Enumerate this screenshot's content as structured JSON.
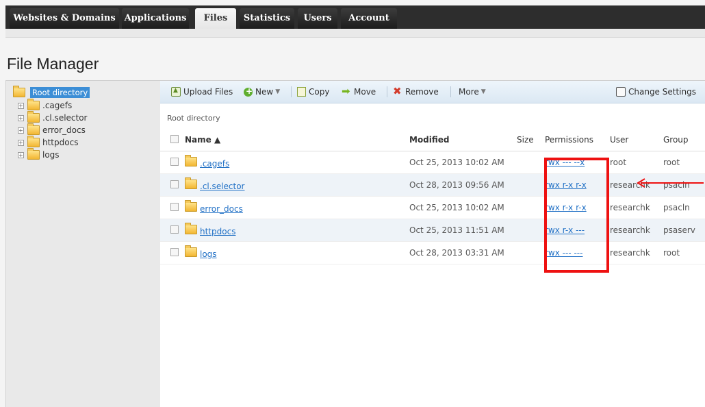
{
  "tabs": [
    {
      "label": "Websites & Domains",
      "active": false
    },
    {
      "label": "Applications",
      "active": false
    },
    {
      "label": "Files",
      "active": true
    },
    {
      "label": "Statistics",
      "active": false
    },
    {
      "label": "Users",
      "active": false
    },
    {
      "label": "Account",
      "active": false
    }
  ],
  "page_title": "File Manager",
  "tree": {
    "root": "Root directory",
    "items": [
      ".cagefs",
      ".cl.selector",
      "error_docs",
      "httpdocs",
      "logs"
    ]
  },
  "toolbar": {
    "upload": "Upload Files",
    "new": "New",
    "copy": "Copy",
    "move": "Move",
    "remove": "Remove",
    "more": "More",
    "change_settings": "Change Settings"
  },
  "breadcrumb": "Root directory",
  "table": {
    "headers": {
      "name": "Name ▲",
      "modified": "Modified",
      "size": "Size",
      "permissions": "Permissions",
      "user": "User",
      "group": "Group"
    },
    "rows": [
      {
        "name": ".cagefs",
        "modified": "Oct 25, 2013 10:02 AM",
        "size": "",
        "permissions": "rwx --- --x",
        "user": "root",
        "group": "root"
      },
      {
        "name": ".cl.selector",
        "modified": "Oct 28, 2013 09:56 AM",
        "size": "",
        "permissions": "rwx r-x r-x",
        "user": "researchk",
        "group": "psacln"
      },
      {
        "name": "error_docs",
        "modified": "Oct 25, 2013 10:02 AM",
        "size": "",
        "permissions": "rwx r-x r-x",
        "user": "researchk",
        "group": "psacln"
      },
      {
        "name": "httpdocs",
        "modified": "Oct 25, 2013 11:51 AM",
        "size": "",
        "permissions": "rwx r-x ---",
        "user": "researchk",
        "group": "psaserv"
      },
      {
        "name": "logs",
        "modified": "Oct 28, 2013 03:31 AM",
        "size": "",
        "permissions": "rwx --- ---",
        "user": "researchk",
        "group": "root"
      }
    ]
  },
  "colors": {
    "accent": "#3c8ed6",
    "link": "#1f6fc5",
    "annotation": "#ee1111"
  }
}
